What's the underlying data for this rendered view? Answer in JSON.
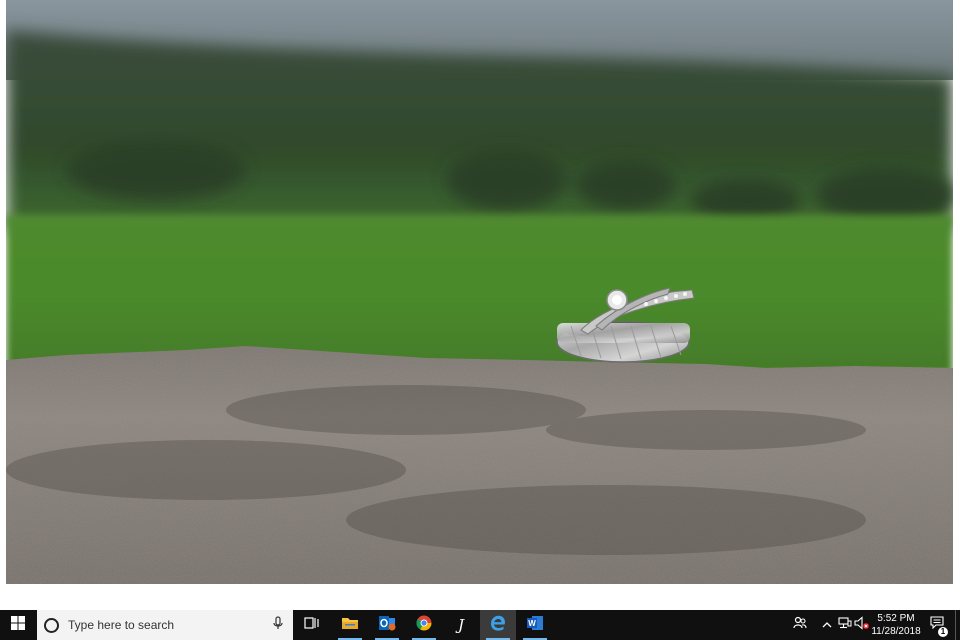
{
  "viewer": {
    "photo_subject": "wedding rings on rock"
  },
  "taskbar": {
    "search_placeholder": "Type here to search",
    "apps": [
      {
        "name": "task-view-icon",
        "running": false
      },
      {
        "name": "file-explorer-icon",
        "running": true
      },
      {
        "name": "outlook-icon",
        "running": true
      },
      {
        "name": "chrome-icon",
        "running": true
      },
      {
        "name": "journal-icon",
        "running": false
      },
      {
        "name": "edge-icon",
        "running": true,
        "active": true
      },
      {
        "name": "word-icon",
        "running": true
      }
    ],
    "clock": {
      "time": "5:52 PM",
      "date": "11/28/2018"
    },
    "notification_count": "1",
    "colors": {
      "taskbar_bg": "#101010",
      "search_bg": "#f3f3f3",
      "running_indicator": "#76b9ed"
    }
  }
}
